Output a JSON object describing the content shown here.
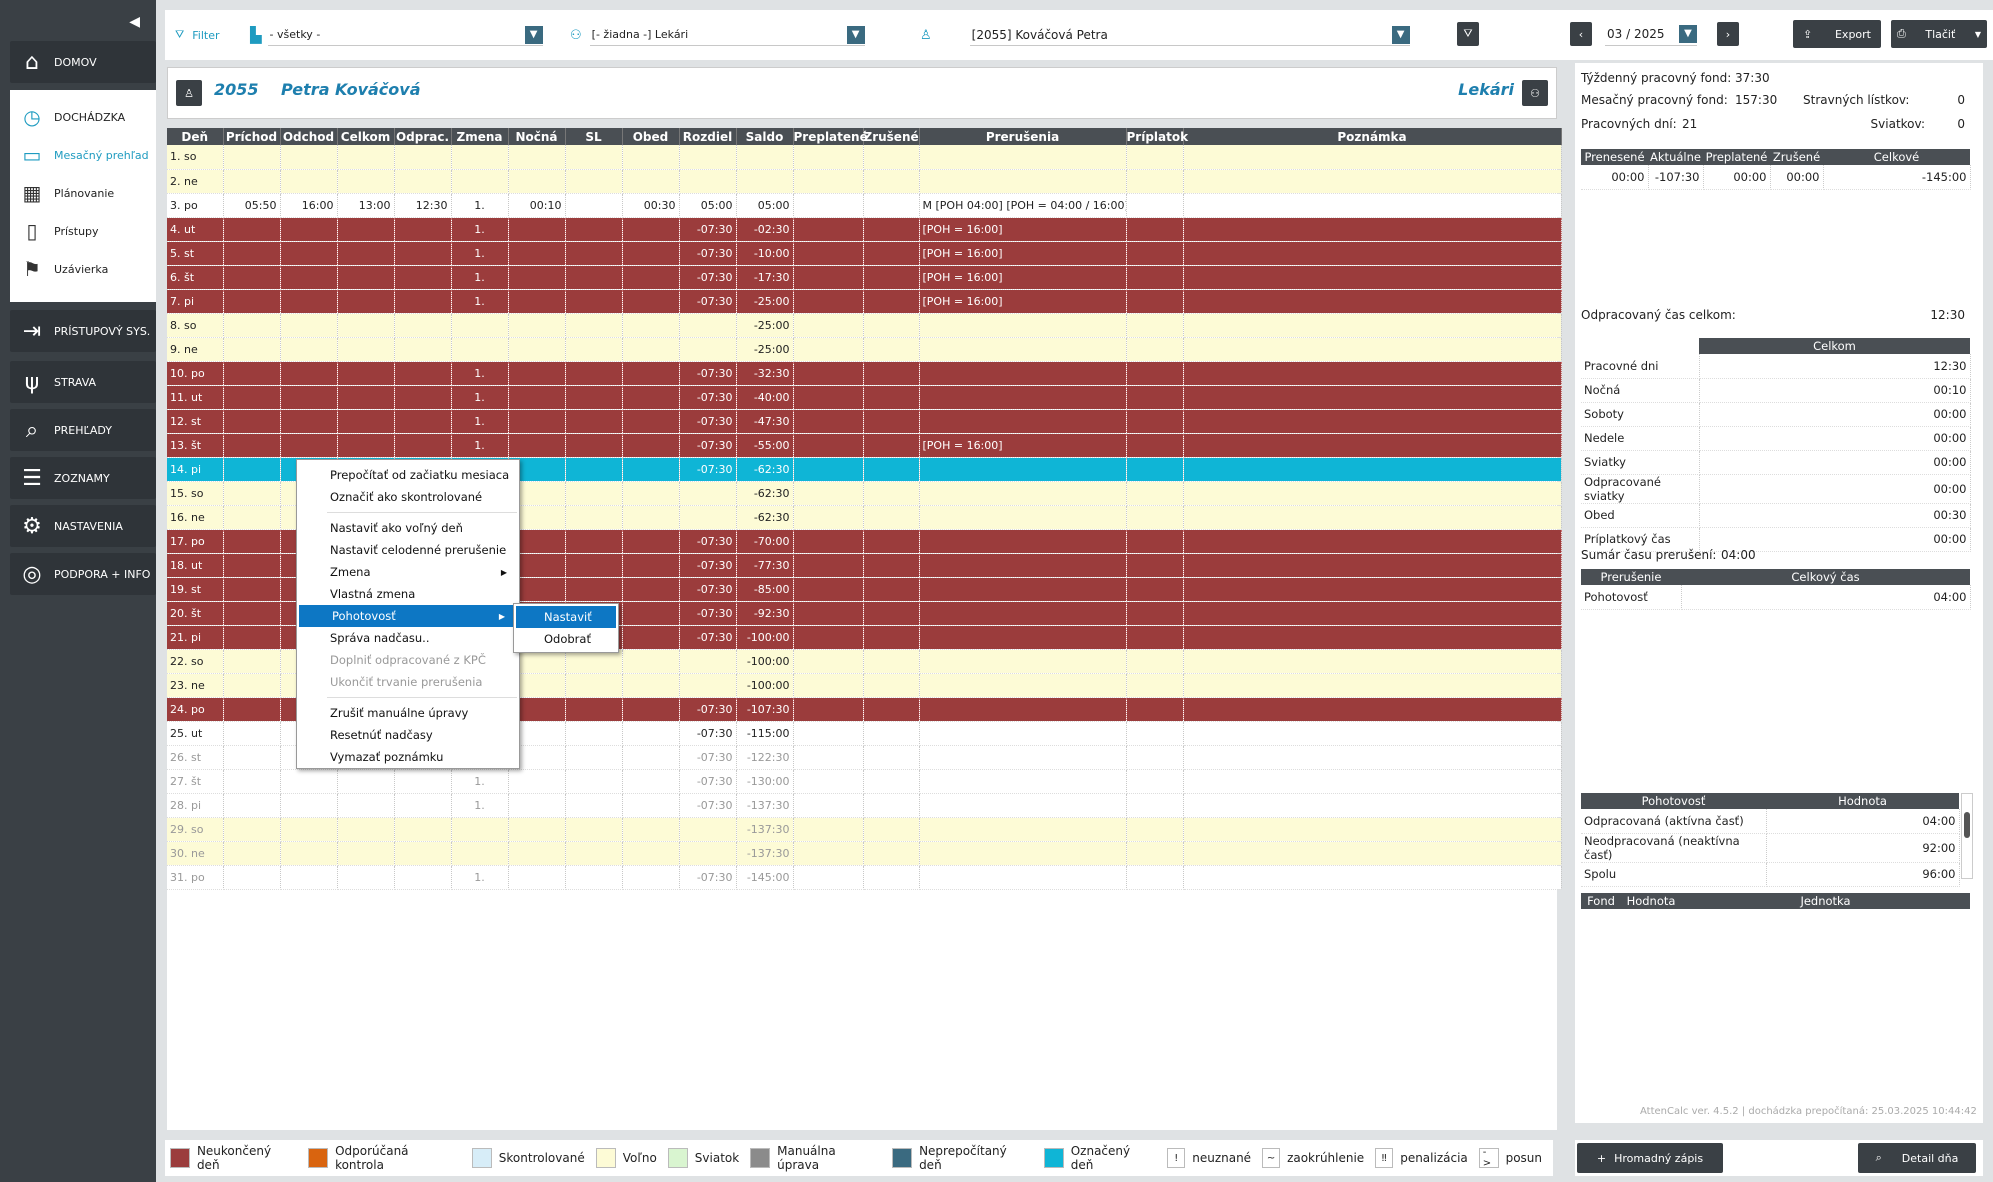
{
  "sidebar": {
    "collapse": "◀",
    "items": [
      {
        "label": "DOMOV",
        "icon": "home-icon"
      },
      {
        "label": "PRÍSTUPOVÝ SYS.",
        "icon": "login-icon"
      },
      {
        "label": "STRAVA",
        "icon": "cutlery-icon"
      },
      {
        "label": "PREHĽADY",
        "icon": "search-icon"
      },
      {
        "label": "ZOZNAMY",
        "icon": "list-icon"
      },
      {
        "label": "NASTAVENIA",
        "icon": "gear-icon"
      },
      {
        "label": "PODPORA + INFO",
        "icon": "lifebuoy-icon"
      }
    ],
    "group": {
      "head": {
        "label": "DOCHÁDZKA",
        "icon": "clock-icon"
      },
      "items": [
        {
          "label": "Mesačný prehľad",
          "icon": "book-icon",
          "active": true
        },
        {
          "label": "Plánovanie",
          "icon": "calendar-icon"
        },
        {
          "label": "Prístupy",
          "icon": "door-icon"
        },
        {
          "label": "Uzávierka",
          "icon": "flag-icon"
        }
      ]
    }
  },
  "toolbar": {
    "filter_label": "Filter",
    "filter1": "- všetky -",
    "filter2": "[- žiadna -] Lekári",
    "employee": "[2055] Kováčová Petra",
    "month": "03 / 2025",
    "export": "Export",
    "print": "Tlačiť"
  },
  "header": {
    "id": "2055",
    "name": "Petra Kováčová",
    "group": "Lekári"
  },
  "grid": {
    "columns": [
      "Deň",
      "Príchod",
      "Odchod",
      "Celkom",
      "Odprac.",
      "Zmena",
      "Nočná",
      "SL",
      "Obed",
      "Rozdiel",
      "Saldo",
      "Preplatené",
      "Zrušené",
      "Prerušenia",
      "Príplatok",
      "Poznámka"
    ],
    "rows": [
      {
        "t": "free",
        "c": [
          "1. so",
          "",
          "",
          "",
          "",
          "",
          "",
          "",
          "",
          "",
          "",
          "",
          "",
          "",
          "",
          ""
        ]
      },
      {
        "t": "free",
        "c": [
          "2. ne",
          "",
          "",
          "",
          "",
          "",
          "",
          "",
          "",
          "",
          "",
          "",
          "",
          "",
          "",
          ""
        ]
      },
      {
        "t": "norm",
        "c": [
          "3. po",
          "05:50",
          "16:00",
          "13:00",
          "12:30",
          "1.",
          "00:10",
          "",
          "00:30",
          "05:00",
          "05:00",
          "",
          "",
          "M [POH 04:00]  [POH = 04:00 / 16:00]",
          "",
          ""
        ]
      },
      {
        "t": "unf",
        "c": [
          "4. ut",
          "",
          "",
          "",
          "",
          "1.",
          "",
          "",
          "",
          "-07:30",
          "-02:30",
          "",
          "",
          "[POH = 16:00]",
          "",
          ""
        ]
      },
      {
        "t": "unf",
        "c": [
          "5. st",
          "",
          "",
          "",
          "",
          "1.",
          "",
          "",
          "",
          "-07:30",
          "-10:00",
          "",
          "",
          "[POH = 16:00]",
          "",
          ""
        ]
      },
      {
        "t": "unf",
        "c": [
          "6. št",
          "",
          "",
          "",
          "",
          "1.",
          "",
          "",
          "",
          "-07:30",
          "-17:30",
          "",
          "",
          "[POH = 16:00]",
          "",
          ""
        ]
      },
      {
        "t": "unf",
        "c": [
          "7. pi",
          "",
          "",
          "",
          "",
          "1.",
          "",
          "",
          "",
          "-07:30",
          "-25:00",
          "",
          "",
          "[POH = 16:00]",
          "",
          ""
        ]
      },
      {
        "t": "free",
        "c": [
          "8. so",
          "",
          "",
          "",
          "",
          "",
          "",
          "",
          "",
          "",
          "-25:00",
          "",
          "",
          "",
          "",
          ""
        ]
      },
      {
        "t": "free",
        "c": [
          "9. ne",
          "",
          "",
          "",
          "",
          "",
          "",
          "",
          "",
          "",
          "-25:00",
          "",
          "",
          "",
          "",
          ""
        ]
      },
      {
        "t": "unf",
        "c": [
          "10. po",
          "",
          "",
          "",
          "",
          "1.",
          "",
          "",
          "",
          "-07:30",
          "-32:30",
          "",
          "",
          "",
          "",
          ""
        ]
      },
      {
        "t": "unf",
        "c": [
          "11. ut",
          "",
          "",
          "",
          "",
          "1.",
          "",
          "",
          "",
          "-07:30",
          "-40:00",
          "",
          "",
          "",
          "",
          ""
        ]
      },
      {
        "t": "unf",
        "c": [
          "12. st",
          "",
          "",
          "",
          "",
          "1.",
          "",
          "",
          "",
          "-07:30",
          "-47:30",
          "",
          "",
          "",
          "",
          ""
        ]
      },
      {
        "t": "unf",
        "c": [
          "13. št",
          "",
          "",
          "",
          "",
          "1.",
          "",
          "",
          "",
          "-07:30",
          "-55:00",
          "",
          "",
          "[POH = 16:00]",
          "",
          ""
        ]
      },
      {
        "t": "sel",
        "c": [
          "14. pi",
          "",
          "",
          "",
          "",
          "",
          "",
          "",
          "",
          "-07:30",
          "-62:30",
          "",
          "",
          "",
          "",
          ""
        ]
      },
      {
        "t": "free",
        "c": [
          "15. so",
          "",
          "",
          "",
          "",
          "",
          "",
          "",
          "",
          "",
          "-62:30",
          "",
          "",
          "",
          "",
          ""
        ]
      },
      {
        "t": "free",
        "c": [
          "16. ne",
          "",
          "",
          "",
          "",
          "",
          "",
          "",
          "",
          "",
          "-62:30",
          "",
          "",
          "",
          "",
          ""
        ]
      },
      {
        "t": "unf",
        "c": [
          "17. po",
          "",
          "",
          "",
          "",
          "",
          "",
          "",
          "",
          "-07:30",
          "-70:00",
          "",
          "",
          "",
          "",
          ""
        ]
      },
      {
        "t": "unf",
        "c": [
          "18. ut",
          "",
          "",
          "",
          "",
          "",
          "",
          "",
          "",
          "-07:30",
          "-77:30",
          "",
          "",
          "",
          "",
          ""
        ]
      },
      {
        "t": "unf",
        "c": [
          "19. st",
          "",
          "",
          "",
          "",
          "",
          "",
          "",
          "",
          "-07:30",
          "-85:00",
          "",
          "",
          "",
          "",
          ""
        ]
      },
      {
        "t": "unf",
        "c": [
          "20. št",
          "",
          "",
          "",
          "",
          "",
          "",
          "",
          "",
          "-07:30",
          "-92:30",
          "",
          "",
          "",
          "",
          ""
        ]
      },
      {
        "t": "unf",
        "c": [
          "21. pi",
          "",
          "",
          "",
          "",
          "",
          "",
          "",
          "",
          "-07:30",
          "-100:00",
          "",
          "",
          "",
          "",
          ""
        ]
      },
      {
        "t": "free",
        "c": [
          "22. so",
          "",
          "",
          "",
          "",
          "",
          "",
          "",
          "",
          "",
          "-100:00",
          "",
          "",
          "",
          "",
          ""
        ]
      },
      {
        "t": "free",
        "c": [
          "23. ne",
          "",
          "",
          "",
          "",
          "",
          "",
          "",
          "",
          "",
          "-100:00",
          "",
          "",
          "",
          "",
          ""
        ]
      },
      {
        "t": "unf",
        "c": [
          "24. po",
          "",
          "",
          "",
          "",
          "",
          "",
          "",
          "",
          "-07:30",
          "-107:30",
          "",
          "",
          "",
          "",
          ""
        ]
      },
      {
        "t": "norm",
        "c": [
          "25. ut",
          "",
          "",
          "",
          "",
          "",
          "",
          "",
          "",
          "-07:30",
          "-115:00",
          "",
          "",
          "",
          "",
          ""
        ]
      },
      {
        "t": "fut",
        "c": [
          "26. st",
          "",
          "",
          "",
          "",
          "",
          "",
          "",
          "",
          "-07:30",
          "-122:30",
          "",
          "",
          "",
          "",
          ""
        ]
      },
      {
        "t": "fut",
        "c": [
          "27. št",
          "",
          "",
          "",
          "",
          "1.",
          "",
          "",
          "",
          "-07:30",
          "-130:00",
          "",
          "",
          "",
          "",
          ""
        ]
      },
      {
        "t": "fut",
        "c": [
          "28. pi",
          "",
          "",
          "",
          "",
          "1.",
          "",
          "",
          "",
          "-07:30",
          "-137:30",
          "",
          "",
          "",
          "",
          ""
        ]
      },
      {
        "t": "futfree",
        "c": [
          "29. so",
          "",
          "",
          "",
          "",
          "",
          "",
          "",
          "",
          "",
          "-137:30",
          "",
          "",
          "",
          "",
          ""
        ]
      },
      {
        "t": "futfree",
        "c": [
          "30. ne",
          "",
          "",
          "",
          "",
          "",
          "",
          "",
          "",
          "",
          "-137:30",
          "",
          "",
          "",
          "",
          ""
        ]
      },
      {
        "t": "fut",
        "c": [
          "31. po",
          "",
          "",
          "",
          "",
          "1.",
          "",
          "",
          "",
          "-07:30",
          "-145:00",
          "",
          "",
          "",
          "",
          ""
        ]
      }
    ]
  },
  "context_menu": {
    "items": [
      {
        "label": "Prepočítať od začiatku mesiaca"
      },
      {
        "label": "Označiť ako skontrolované"
      },
      {
        "sep": true
      },
      {
        "label": "Nastaviť ako voľný deň"
      },
      {
        "label": "Nastaviť celodenné prerušenie"
      },
      {
        "label": "Zmena",
        "sub": true
      },
      {
        "label": "Vlastná zmena"
      },
      {
        "label": "Pohotovosť",
        "sub": true,
        "hl": true
      },
      {
        "label": "Správa nadčasu.."
      },
      {
        "label": "Doplniť odpracované z KPČ",
        "dis": true
      },
      {
        "label": "Ukončiť trvanie prerušenia",
        "dis": true
      },
      {
        "sep": true
      },
      {
        "label": "Zrušiť manuálne úpravy"
      },
      {
        "label": "Resetnúť nadčasy"
      },
      {
        "label": "Vymazať poznámku"
      }
    ],
    "submenu": [
      "Nastaviť",
      "Odobrať"
    ]
  },
  "right": {
    "week_fund_label": "Týždenný pracovný fond:",
    "week_fund": "37:30",
    "month_fund_label": "Mesačný pracovný fond:",
    "month_fund": "157:30",
    "meal_label": "Stravných lístkov:",
    "meal": "0",
    "workdays_label": "Pracovných dní:",
    "workdays": "21",
    "holidays_label": "Sviatkov:",
    "holidays": "0",
    "balance_headers": [
      "Prenesené",
      "Aktuálne",
      "Preplatené",
      "Zrušené",
      "Celkové"
    ],
    "balance_values": [
      "00:00",
      "-107:30",
      "00:00",
      "00:00",
      "-145:00"
    ],
    "worked_total_label": "Odpracovaný čas celkom:",
    "worked_total": "12:30",
    "summary_header": "Celkom",
    "summary": [
      [
        "Pracovné dni",
        "12:30"
      ],
      [
        "Nočná",
        "00:10"
      ],
      [
        "Soboty",
        "00:00"
      ],
      [
        "Nedele",
        "00:00"
      ],
      [
        "Sviatky",
        "00:00"
      ],
      [
        "Odpracované sviatky",
        "00:00"
      ],
      [
        "Obed",
        "00:30"
      ],
      [
        "Príplatkový čas",
        "00:00"
      ]
    ],
    "breaks_total_label": "Sumár času prerušení:",
    "breaks_total": "04:00",
    "breaks_headers": [
      "Prerušenie",
      "Celkový čas"
    ],
    "breaks": [
      [
        "Pohotovosť",
        "04:00"
      ]
    ],
    "standby_headers": [
      "Pohotovosť",
      "Hodnota"
    ],
    "standby": [
      [
        "Odpracovaná (aktívna časť)",
        "04:00"
      ],
      [
        "Neodpracovaná (neaktívna časť)",
        "92:00"
      ],
      [
        "Spolu",
        "96:00"
      ]
    ],
    "fund_headers": [
      "Fond",
      "Hodnota",
      "Jednotka"
    ],
    "version": "AttenCalc ver. 4.5.2 | dochádzka prepočítaná: 25.03.2025 10:44:42",
    "mass_entry": "Hromadný zápis",
    "day_detail": "Detail dňa"
  },
  "legend": [
    {
      "label": "Neukončený deň",
      "color": "#9b3c3c"
    },
    {
      "label": "Odporúčaná kontrola",
      "color": "#d9640f"
    },
    {
      "label": "Skontrolované",
      "color": "#d7edf8"
    },
    {
      "label": "Voľno",
      "color": "#fdfbd6"
    },
    {
      "label": "Sviatok",
      "color": "#d9f5d0"
    },
    {
      "label": "Manuálna úprava",
      "color": "#8b8b8b"
    },
    {
      "label": "Neprepočítaný deň",
      "color": "#3a6a80"
    },
    {
      "label": "Označený deň",
      "color": "#0fb5d6"
    }
  ],
  "legend_symbols": [
    {
      "sym": "!",
      "label": "neuznané"
    },
    {
      "sym": "~",
      "label": "zaokrúhlenie"
    },
    {
      "sym": "‼",
      "label": "penalizácia"
    },
    {
      "sym": "->",
      "label": "posun"
    }
  ]
}
